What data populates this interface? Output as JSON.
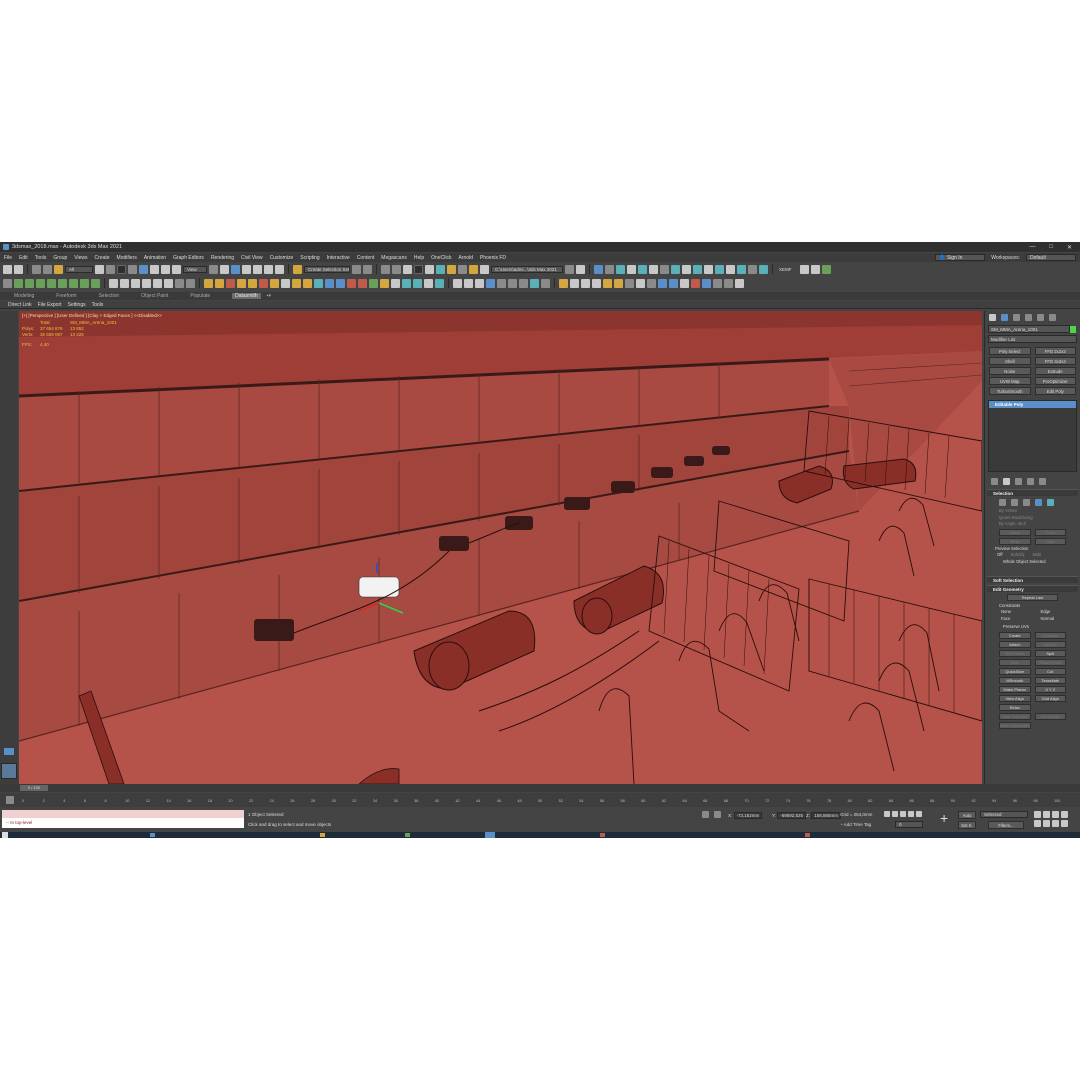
{
  "window": {
    "title": "3dsmax_2018.max - Autodesk 3ds Max 2021",
    "controls": [
      "—",
      "□",
      "✕"
    ]
  },
  "menubar": {
    "items": [
      "File",
      "Edit",
      "Tools",
      "Group",
      "Views",
      "Create",
      "Modifiers",
      "Animation",
      "Graph Editors",
      "Rendering",
      "Civil View",
      "Customize",
      "Scripting",
      "Interactive",
      "Content",
      "Megascans",
      "Help",
      "OneClick",
      "Arnold",
      "Phoenix FD"
    ],
    "sign_in": "Sign In",
    "workspaces_label": "Workspaces:",
    "workspaces_value": "Default"
  },
  "toolbar": {
    "filter_value": "All",
    "view_value": "View",
    "selection_set": "Create Selection Set",
    "path_value": "C:\\Users\\admi...\\3ds Max 2021",
    "axis_label": "XEMF"
  },
  "ribbon": {
    "tabs": [
      "Modeling",
      "Freeform",
      "Selection",
      "Object Paint",
      "Populate",
      "Datasmith"
    ]
  },
  "subribbon": {
    "items": [
      "Direct Link",
      "File Export",
      "Settings",
      "Tools"
    ]
  },
  "viewport": {
    "label": "[+] [Perspective ] [User Defined ] [Clay + Edged Faces ] <<Disabled>>",
    "stats": {
      "total_label": "Total",
      "object_name": "SM_MMA_Arena_1001",
      "polys_label": "Polys:",
      "polys_total": "37 654 676",
      "polys_sel": "13 852",
      "verts_label": "Verts:",
      "verts_total": "35 559 087",
      "verts_sel": "13 226",
      "fps_label": "FPS:",
      "fps_value": "4,40"
    }
  },
  "command_panel": {
    "object_name": "SM_MMA_Arena_1001",
    "modifier_list": "Modifier List",
    "buttons": [
      "Poly Select",
      "FFD 2x2x2",
      "Shell",
      "FFD 3x3x3",
      "Noise",
      "Extrude",
      "UVW Map",
      "ProOptimizer",
      "TurboSmooth",
      "Edit Poly"
    ],
    "stack_item": "Editable Poly",
    "selection_title": "Selection",
    "selection_opts": [
      "By Vertex",
      "Ignore Backfacing",
      "By Angle: 45,0"
    ],
    "sel_buttons": [
      "Shrink",
      "Grow",
      "Ring",
      "Loop"
    ],
    "preview_label": "Preview Selection",
    "preview_opts": [
      "Off",
      "SubObj",
      "Multi"
    ],
    "whole_object": "Whole Object Selected",
    "soft_selection": "Soft Selection",
    "edit_geometry": "Edit Geometry",
    "repeat_last": "Repeat Last",
    "constraints": "Constraints",
    "constraint_opts": [
      "None",
      "Edge",
      "Face",
      "Normal"
    ],
    "preserve_uvs": "Preserve UVs",
    "geo_buttons": [
      "Create",
      "Collapse",
      "Attach",
      "Detach",
      "Slice Plane",
      "Split",
      "Slice",
      "Reset Plane",
      "QuickSlice",
      "Cut",
      "MSmooth",
      "Tessellate",
      "Make Planar",
      "X  Y  Z",
      "View Align",
      "Grid Align",
      "Relax",
      "Hide Selected",
      "Unhide All",
      "Hide Unselected"
    ]
  },
  "timeline": {
    "frame": "0 / 100",
    "ticks": [
      "0",
      "2",
      "4",
      "6",
      "8",
      "10",
      "12",
      "14",
      "16",
      "18",
      "20",
      "22",
      "24",
      "26",
      "28",
      "30",
      "32",
      "34",
      "36",
      "38",
      "40",
      "42",
      "44",
      "46",
      "48",
      "50",
      "52",
      "54",
      "56",
      "58",
      "60",
      "62",
      "64",
      "66",
      "68",
      "70",
      "72",
      "74",
      "76",
      "78",
      "80",
      "82",
      "84",
      "86",
      "88",
      "90",
      "92",
      "94",
      "96",
      "98",
      "100"
    ]
  },
  "status": {
    "maxscript": "-- In top-level",
    "selected": "1 Object Selected",
    "hint": "Click and drag to select and move objects",
    "x_label": "X:",
    "x_value": "-73,162mm",
    "y_label": "Y:",
    "y_value": "-69592,525",
    "z_label": "Z:",
    "z_value": "158,865mm",
    "grid": "Grid = 254,0mm",
    "add_time_tag": "Add Time Tag",
    "auto": "Auto",
    "set_k": "Set K.",
    "selected_combo": "Selected",
    "filters": "Filters...",
    "frame_field": "0"
  }
}
